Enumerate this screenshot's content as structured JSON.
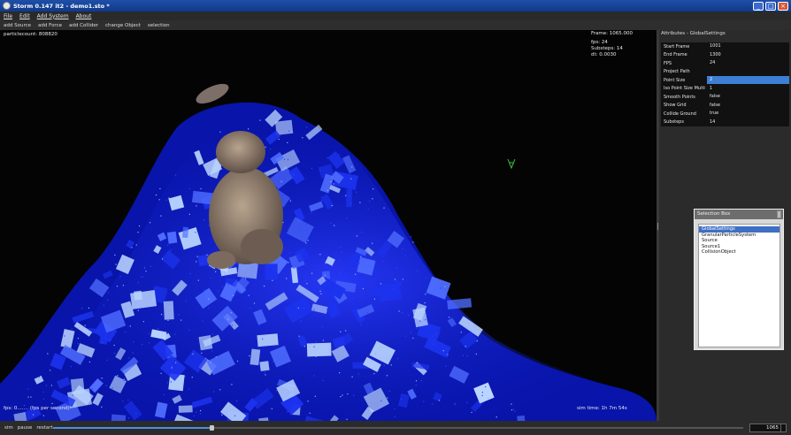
{
  "window": {
    "title": "Storm 0.147 it2 - demo1.sto *",
    "minimize": "_",
    "maximize": "□",
    "close": "×"
  },
  "menu": [
    "File",
    "Edit",
    "Add System",
    "About"
  ],
  "toolbar": [
    "add Source",
    "add Force",
    "add Collider",
    "change Object",
    "selection"
  ],
  "viewport": {
    "particle_count": "particlecount: 808820",
    "frame": "Frame: 1065.000",
    "fps": "fps: 24",
    "substeps": "Substeps: 14",
    "dt": "dt: 0.0030",
    "speed": "fps: 0.…… (fps per second)",
    "sim_time": "sim time:  1h 7m 54s"
  },
  "attributes": {
    "header": "Attributes - GlobalSettings",
    "rows": [
      {
        "k": "Start Frame",
        "v": "1001"
      },
      {
        "k": "End Frame",
        "v": "1300"
      },
      {
        "k": "FPS",
        "v": "24"
      },
      {
        "k": "Project Path",
        "v": ""
      },
      {
        "k": "Point Size",
        "v": "2"
      },
      {
        "k": "Iso Point Size Multi",
        "v": "1"
      },
      {
        "k": "Smooth Points",
        "v": "false"
      },
      {
        "k": "Show Grid",
        "v": "false"
      },
      {
        "k": "Collide Ground",
        "v": "true"
      },
      {
        "k": "Substeps",
        "v": "14"
      }
    ],
    "selected_index": 4
  },
  "selection_box": {
    "title": "Selection Box",
    "items": [
      "GlobalSettings",
      "GranularParticleSystem",
      "Source",
      "Source1",
      "CollisionObject"
    ],
    "selected_index": 0
  },
  "status": {
    "buttons": [
      "sim",
      "pause",
      "restart"
    ],
    "progress": 0.23,
    "frame_value": "1065"
  },
  "colors": {
    "accent": "#3e7fd4",
    "particles": "#1a2cff",
    "title_bar": "#1f4fa8"
  }
}
